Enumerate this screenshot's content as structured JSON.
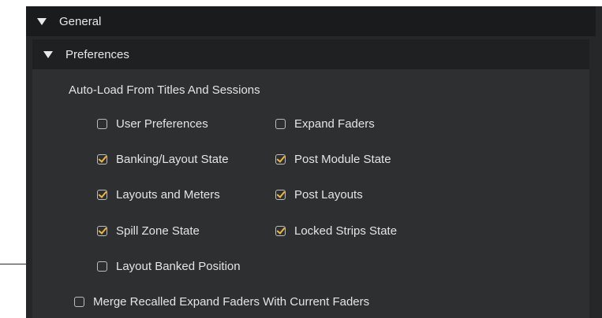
{
  "general": {
    "label": "General"
  },
  "preferences": {
    "label": "Preferences"
  },
  "auto_load": {
    "label": "Auto-Load From Titles And Sessions",
    "options": [
      {
        "label": "User Preferences",
        "checked": false
      },
      {
        "label": "Expand Faders",
        "checked": false
      },
      {
        "label": "Banking/Layout State",
        "checked": true
      },
      {
        "label": "Post Module State",
        "checked": true
      },
      {
        "label": "Layouts and Meters",
        "checked": true
      },
      {
        "label": "Post Layouts",
        "checked": true
      },
      {
        "label": "Spill Zone State",
        "checked": true
      },
      {
        "label": "Locked Strips State",
        "checked": true
      },
      {
        "label": "Layout Banked Position",
        "checked": false
      }
    ]
  },
  "merge_option": {
    "label": "Merge Recalled Expand Faders With Current Faders",
    "checked": false
  },
  "colors": {
    "accent_check": "#f2b63b",
    "panel_bg": "#2d2f31"
  }
}
